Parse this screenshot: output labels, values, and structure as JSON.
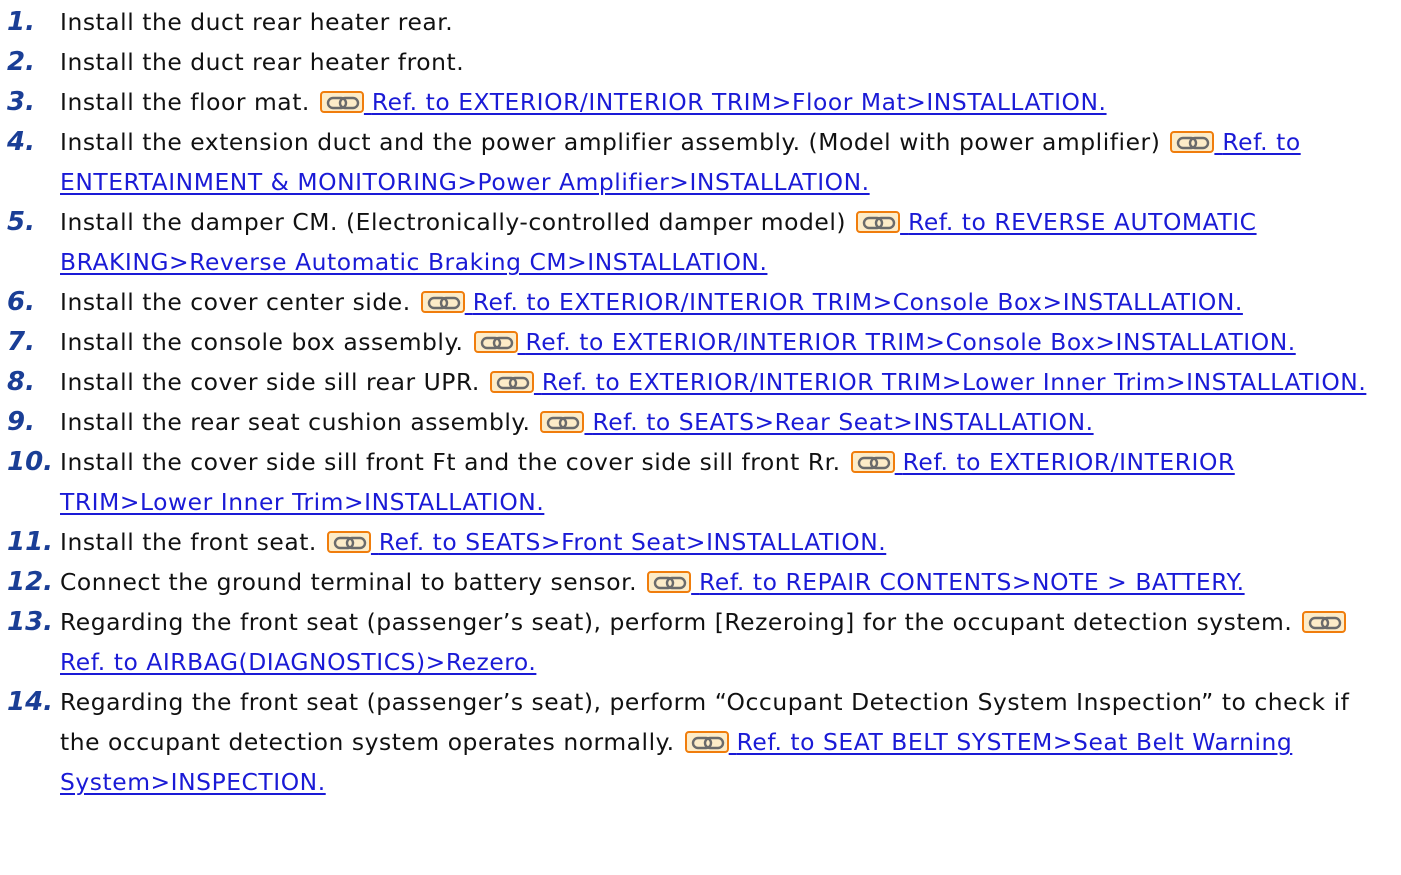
{
  "icons": {
    "link": "chain-link-icon"
  },
  "colors": {
    "number": "#1a3e96",
    "link": "#1a1ad6",
    "icon_border": "#f07d0c",
    "icon_fill": "#fdecc8"
  },
  "steps": [
    {
      "num": "1.",
      "text": "Install the duct rear heater rear.",
      "ref": null
    },
    {
      "num": "2.",
      "text": "Install the duct rear heater front.",
      "ref": null
    },
    {
      "num": "3.",
      "text": "Install the floor mat.",
      "ref": "Ref. to EXTERIOR/INTERIOR TRIM>Floor Mat>INSTALLATION."
    },
    {
      "num": "4.",
      "text": "Install the extension duct and the power amplifier assembly. (Model with power amplifier)",
      "ref": "Ref. to ENTERTAINMENT & MONITORING>Power Amplifier>INSTALLATION."
    },
    {
      "num": "5.",
      "text": "Install the damper CM. (Electronically-controlled damper model)",
      "ref": "Ref. to REVERSE AUTOMATIC BRAKING>Reverse Automatic Braking CM>INSTALLATION."
    },
    {
      "num": "6.",
      "text": "Install the cover center side.",
      "ref": "Ref. to EXTERIOR/INTERIOR TRIM>Console Box>INSTALLATION."
    },
    {
      "num": "7.",
      "text": "Install the console box assembly.",
      "ref": "Ref. to EXTERIOR/INTERIOR TRIM>Console Box>INSTALLATION."
    },
    {
      "num": "8.",
      "text": "Install the cover side sill rear UPR.",
      "ref": "Ref. to EXTERIOR/INTERIOR TRIM>Lower Inner Trim>INSTALLATION."
    },
    {
      "num": "9.",
      "text": "Install the rear seat cushion assembly.",
      "ref": "Ref. to SEATS>Rear Seat>INSTALLATION."
    },
    {
      "num": "10.",
      "text": "Install the cover side sill front Ft and the cover side sill front Rr.",
      "ref": "Ref. to EXTERIOR/INTERIOR TRIM>Lower Inner Trim>INSTALLATION."
    },
    {
      "num": "11.",
      "text": "Install the front seat.",
      "ref": "Ref. to SEATS>Front Seat>INSTALLATION."
    },
    {
      "num": "12.",
      "text": "Connect the ground terminal to battery sensor.",
      "ref": "Ref. to REPAIR CONTENTS>NOTE > BATTERY."
    },
    {
      "num": "13.",
      "text": "Regarding the front seat (passenger’s seat), perform [Rezeroing] for the occupant detection system.",
      "ref": "Ref. to AIRBAG(DIAGNOSTICS)>Rezero."
    },
    {
      "num": "14.",
      "text": "Regarding the front seat (passenger’s seat), perform “Occupant Detection System Inspection” to check if the occupant detection system operates normally.",
      "ref": "Ref. to SEAT BELT SYSTEM>Seat Belt Warning System>INSPECTION."
    }
  ]
}
